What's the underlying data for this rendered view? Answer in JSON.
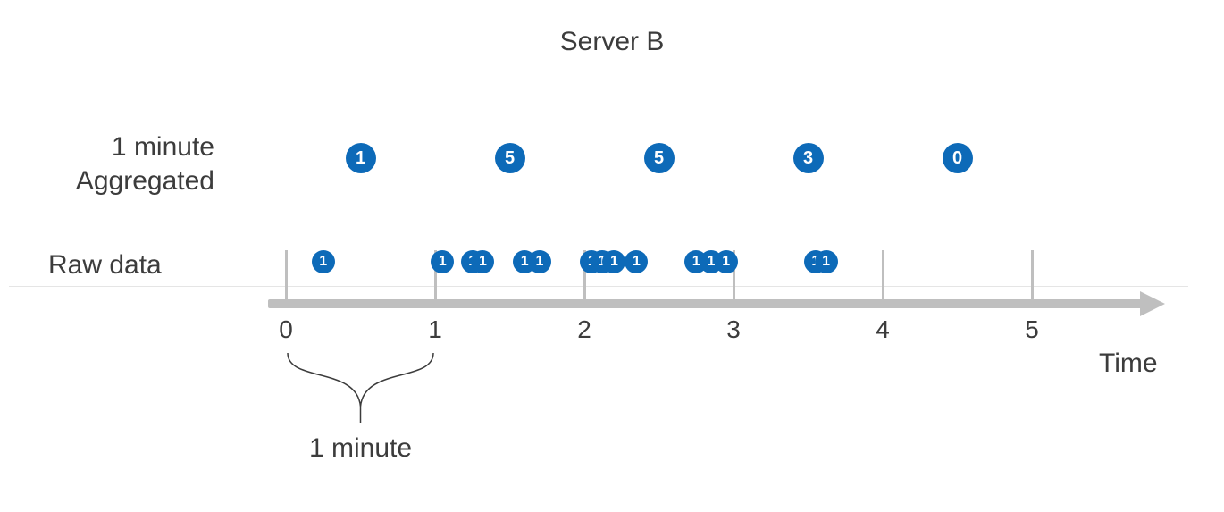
{
  "title": "Server B",
  "labels": {
    "aggregated_line1": "1 minute",
    "aggregated_line2": "Aggregated",
    "raw": "Raw data",
    "axis": "Time",
    "interval": "1 minute"
  },
  "colors": {
    "accent": "#0d6ab8",
    "axis": "#bfbfbf"
  },
  "chart_data": {
    "type": "scatter",
    "xlabel": "Time",
    "xlim": [
      0,
      5
    ],
    "ticks": [
      0,
      1,
      2,
      3,
      4,
      5
    ],
    "interval_label": "1 minute",
    "series": [
      {
        "name": "1 minute Aggregated",
        "x": [
          0.5,
          1.5,
          2.5,
          3.5,
          4.5
        ],
        "values": [
          1,
          5,
          5,
          3,
          0
        ]
      },
      {
        "name": "Raw data",
        "x": [
          0.25,
          1.05,
          1.25,
          1.32,
          1.6,
          1.7,
          2.05,
          2.12,
          2.2,
          2.35,
          2.75,
          2.85,
          2.95,
          3.55,
          3.62
        ],
        "values": [
          1,
          1,
          1,
          1,
          1,
          1,
          1,
          1,
          1,
          1,
          1,
          1,
          1,
          1,
          1
        ]
      }
    ]
  }
}
